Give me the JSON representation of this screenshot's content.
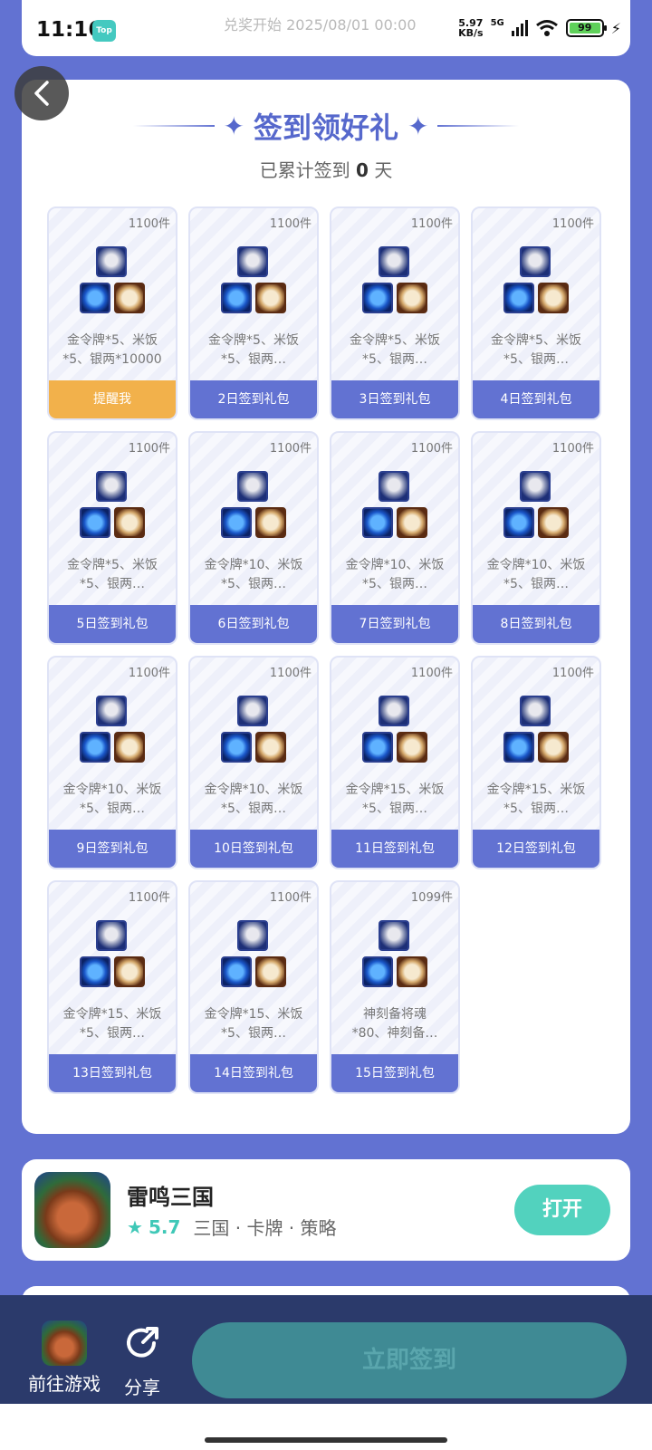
{
  "status": {
    "time": "11:16",
    "app_badge": "Top",
    "notice": "兑奖开始 2025/08/01 00:00",
    "net_speed_value": "5.97",
    "net_speed_unit": "KB/s",
    "network": "5G",
    "battery": "99"
  },
  "header": {
    "title": "签到领好礼",
    "subtitle_prefix": "已累计签到",
    "days": "0",
    "subtitle_suffix": "天"
  },
  "gifts": [
    {
      "count": "1100件",
      "line1": "金令牌*5、米饭",
      "line2": "*5、银两*10000",
      "button": "提醒我"
    },
    {
      "count": "1100件",
      "line1": "金令牌*5、米饭",
      "line2": "*5、银两…",
      "button": "2日签到礼包"
    },
    {
      "count": "1100件",
      "line1": "金令牌*5、米饭",
      "line2": "*5、银两…",
      "button": "3日签到礼包"
    },
    {
      "count": "1100件",
      "line1": "金令牌*5、米饭",
      "line2": "*5、银两…",
      "button": "4日签到礼包"
    },
    {
      "count": "1100件",
      "line1": "金令牌*5、米饭",
      "line2": "*5、银两…",
      "button": "5日签到礼包"
    },
    {
      "count": "1100件",
      "line1": "金令牌*10、米饭",
      "line2": "*5、银两…",
      "button": "6日签到礼包"
    },
    {
      "count": "1100件",
      "line1": "金令牌*10、米饭",
      "line2": "*5、银两…",
      "button": "7日签到礼包"
    },
    {
      "count": "1100件",
      "line1": "金令牌*10、米饭",
      "line2": "*5、银两…",
      "button": "8日签到礼包"
    },
    {
      "count": "1100件",
      "line1": "金令牌*10、米饭",
      "line2": "*5、银两…",
      "button": "9日签到礼包"
    },
    {
      "count": "1100件",
      "line1": "金令牌*10、米饭",
      "line2": "*5、银两…",
      "button": "10日签到礼包"
    },
    {
      "count": "1100件",
      "line1": "金令牌*15、米饭",
      "line2": "*5、银两…",
      "button": "11日签到礼包"
    },
    {
      "count": "1100件",
      "line1": "金令牌*15、米饭",
      "line2": "*5、银两…",
      "button": "12日签到礼包"
    },
    {
      "count": "1100件",
      "line1": "金令牌*15、米饭",
      "line2": "*5、银两…",
      "button": "13日签到礼包"
    },
    {
      "count": "1100件",
      "line1": "金令牌*15、米饭",
      "line2": "*5、银两…",
      "button": "14日签到礼包"
    },
    {
      "count": "1099件",
      "line1": "神刻备将魂",
      "line2": "*80、神刻备…",
      "button": "15日签到礼包"
    }
  ],
  "game": {
    "name": "雷鸣三国",
    "rating": "5.7",
    "tags": "三国 · 卡牌 · 策略",
    "open_label": "打开"
  },
  "bottom": {
    "go_label": "前往游戏",
    "share_label": "分享",
    "sign_label": "立即签到"
  },
  "colors": {
    "background": "#6272d2",
    "accent": "#5668cc",
    "remind": "#f2b14b",
    "open": "#52d2be",
    "bottom_bar": "#2b3a6b"
  }
}
